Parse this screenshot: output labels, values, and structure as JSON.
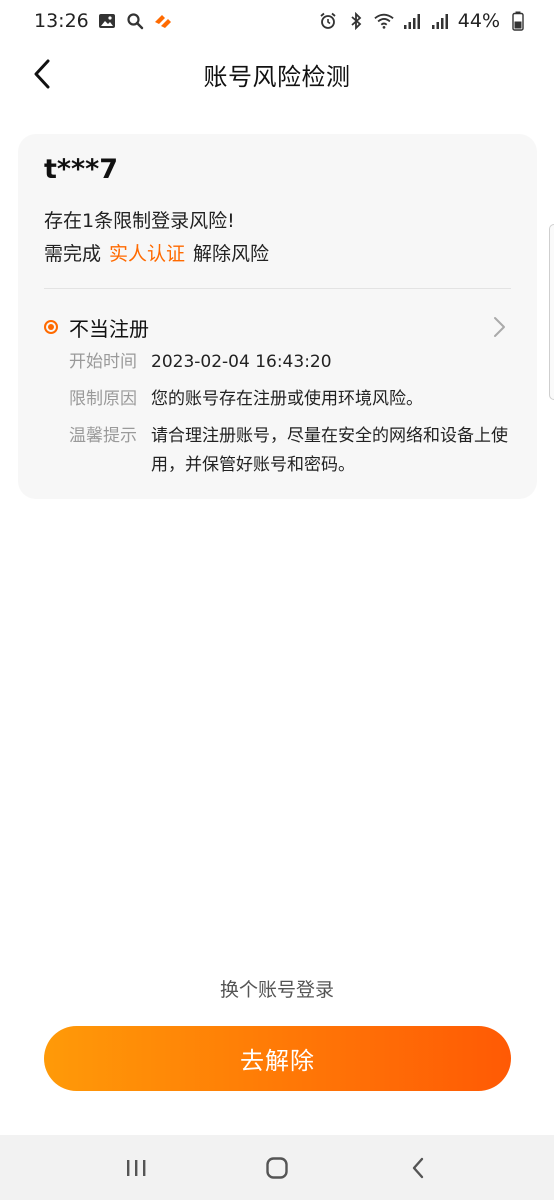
{
  "status_bar": {
    "time": "13:26",
    "battery": "44%",
    "left_icons": [
      "gallery-icon",
      "search-icon",
      "app-notification-icon"
    ],
    "right_icons": [
      "alarm-icon",
      "bluetooth-icon",
      "wifi-icon",
      "signal-icon",
      "signal-icon",
      "battery-icon"
    ]
  },
  "header": {
    "title": "账号风险检测"
  },
  "card": {
    "account": "t***7",
    "summary": "存在1条限制登录风险!",
    "remedy_prefix": "需完成",
    "remedy_link": "实人认证",
    "remedy_suffix": "解除风险",
    "risk_item": {
      "title": "不当注册",
      "details": [
        {
          "label": "开始时间",
          "value": "2023-02-04 16:43:20"
        },
        {
          "label": "限制原因",
          "value": "您的账号存在注册或使用环境风险。"
        },
        {
          "label": "温馨提示",
          "value": "请合理注册账号，尽量在安全的网络和设备上使用，并保管好账号和密码。"
        }
      ]
    }
  },
  "actions": {
    "switch_account": "换个账号登录",
    "primary_button": "去解除"
  },
  "colors": {
    "accent": "#ff6a00",
    "button_start": "#ff9a08",
    "button_end": "#ff5a05",
    "card_bg": "#f7f7f7"
  }
}
